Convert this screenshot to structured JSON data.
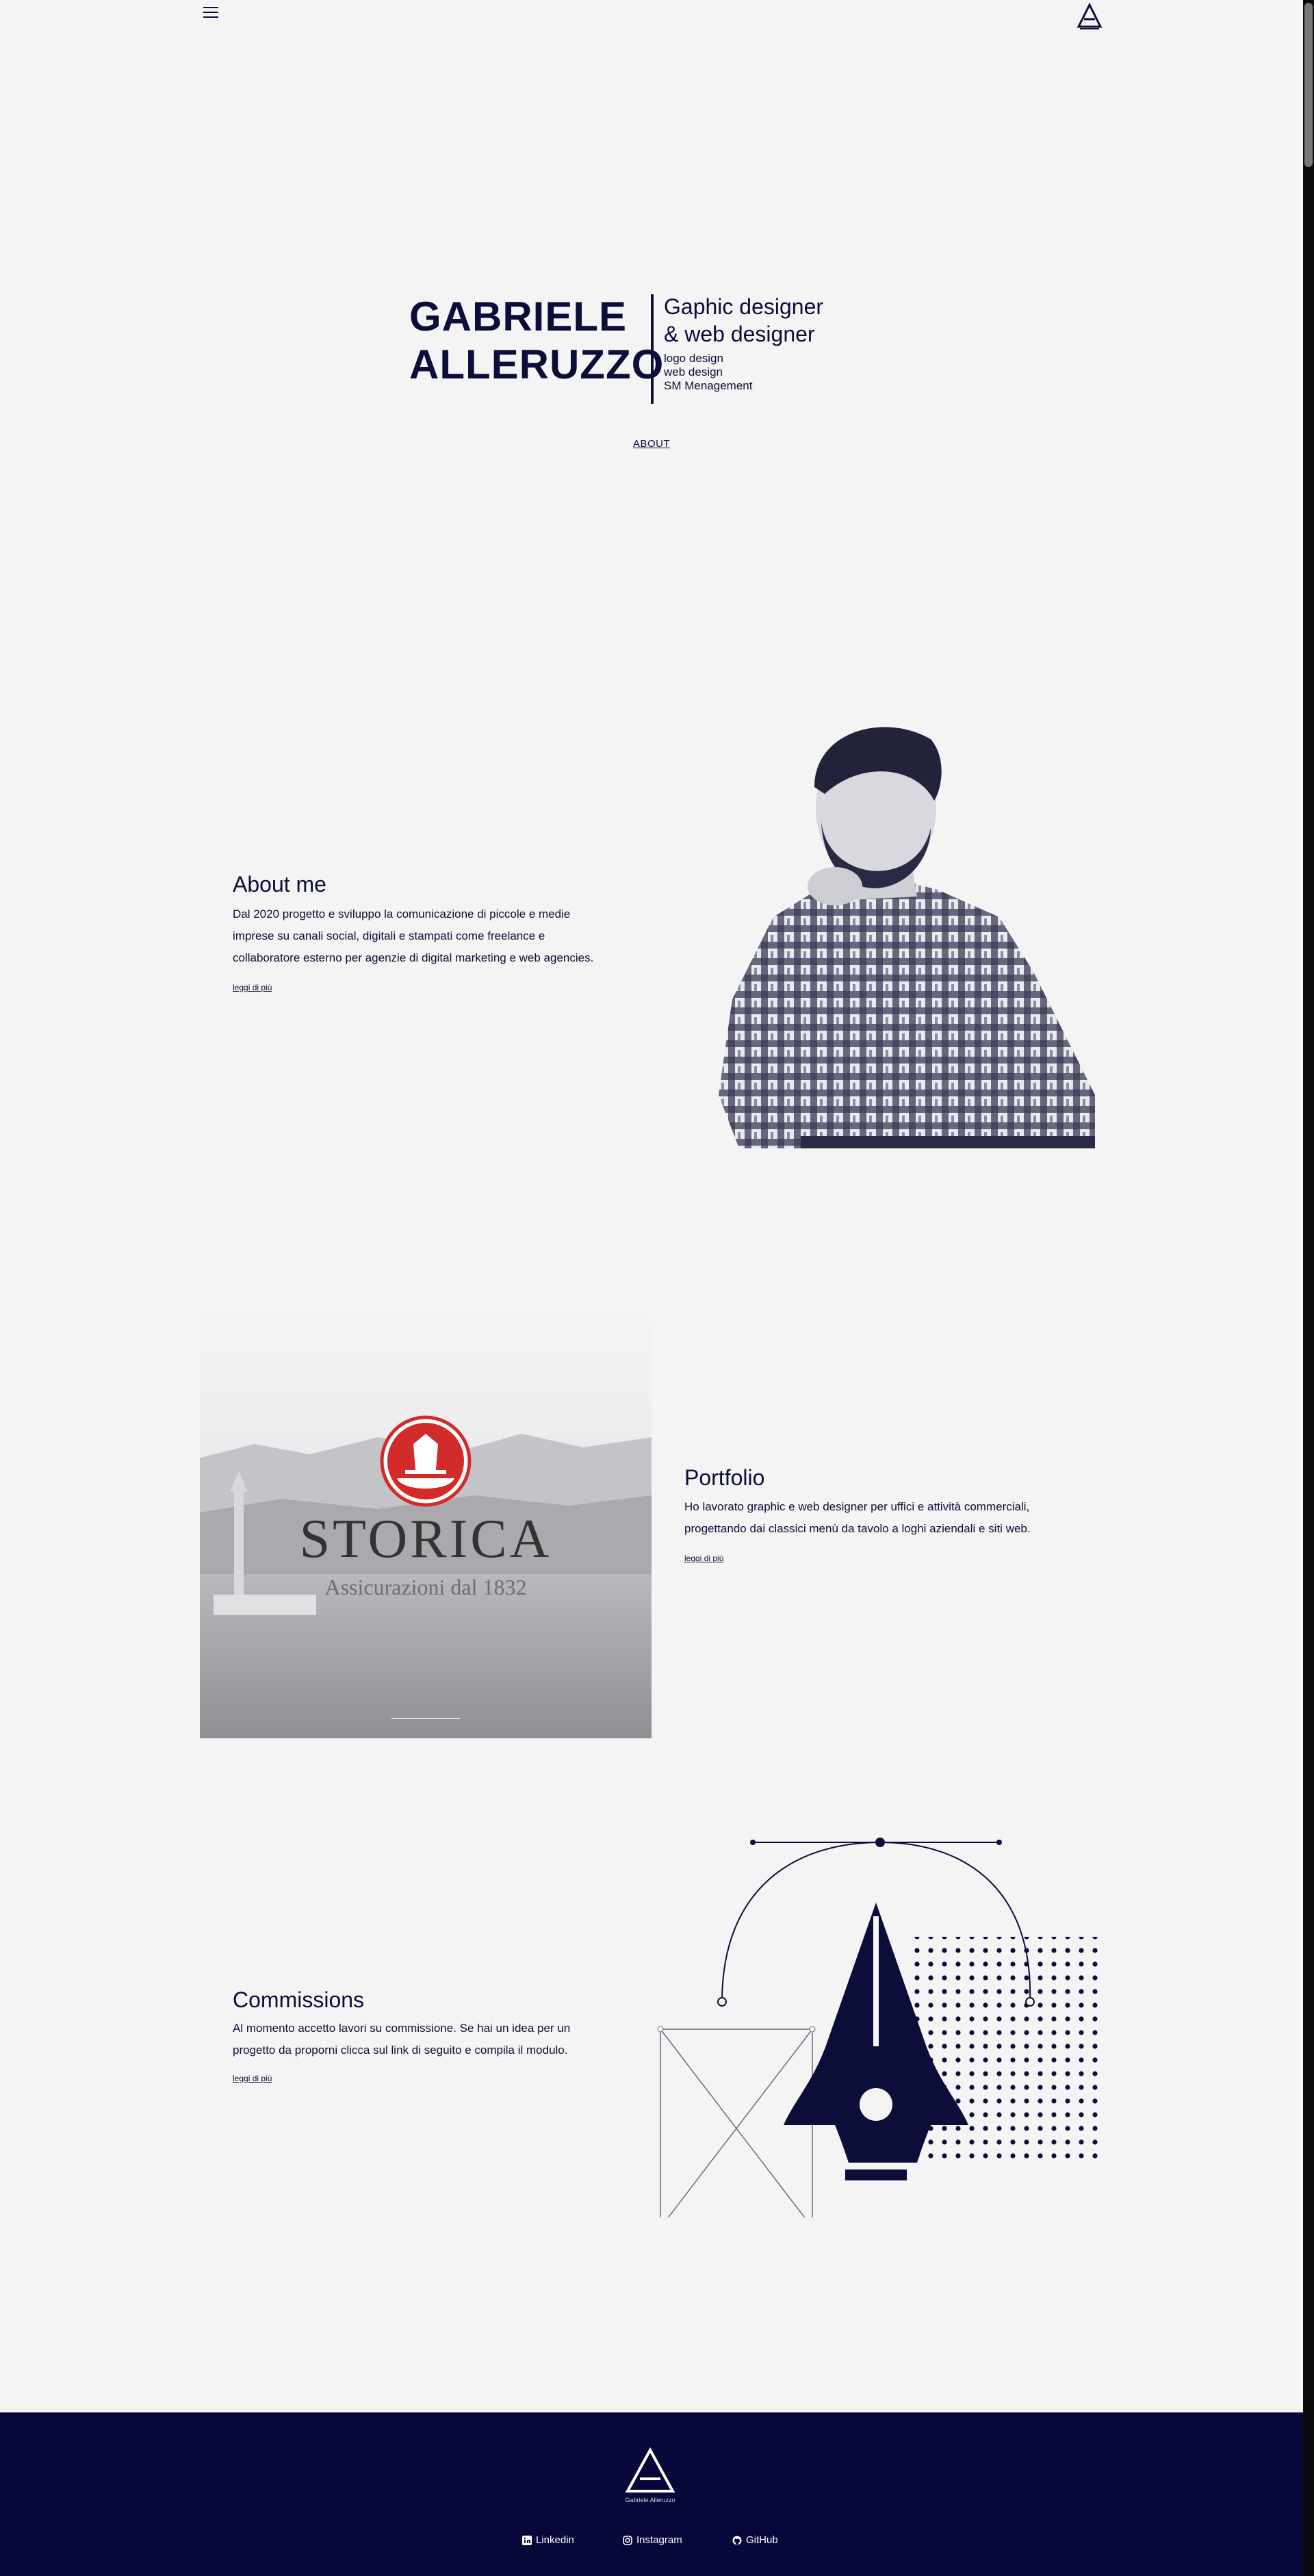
{
  "header": {
    "menu_icon": "hamburger-icon",
    "logo_icon": "ag-monogram-logo"
  },
  "hero": {
    "name_line1": "GABRIELE",
    "name_line2": "ALLERUZZO",
    "role_line1": "Gaphic designer",
    "role_line2": "& web designer",
    "skills": [
      "logo design",
      "web design",
      "SM Menagement"
    ],
    "about_link": "ABOUT"
  },
  "about": {
    "title": "About me",
    "text_lines": [
      "Dal 2020 progetto e sviluppo la comunicazione di piccole e medie",
      "imprese su canali social, digitali e stampati come freelance e",
      "collaboratore esterno per agenzie di digital marketing e web agencies."
    ],
    "link": "leggi di più"
  },
  "portfolio": {
    "brand": "STORICA",
    "brand_sub": "Assicurazioni dal 1832",
    "title": "Portfolio",
    "text_lines": [
      "Ho lavorato graphic e web designer per uffici e attività commerciali,",
      "progettando dai classici menù da tavolo a loghi aziendali e siti web."
    ],
    "link": "leggi di più"
  },
  "commissions": {
    "title": "Commissions",
    "text_lines": [
      "Al momento accetto lavori su commissione. Se hai un idea per un",
      "progetto da proporni clicca sul link di seguito e compila il modulo."
    ],
    "link": "leggi di più"
  },
  "footer": {
    "logo_caption": "Gabriele Alleruzzo",
    "social": [
      {
        "label": "Linkedin",
        "icon": "linkedin-icon"
      },
      {
        "label": "Instagram",
        "icon": "instagram-icon"
      },
      {
        "label": "GitHub",
        "icon": "github-icon"
      }
    ]
  },
  "colors": {
    "navy": "#0d0d3a",
    "footer_bg": "#07073a",
    "page_bg": "#f4f4f4",
    "brand_red": "#d32a2a"
  }
}
